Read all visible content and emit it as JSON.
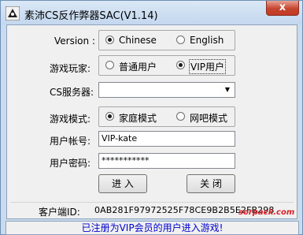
{
  "window": {
    "title": "素沛CS反作弊器SAC(V1.14)",
    "close_label": "x"
  },
  "version": {
    "label": "Version :",
    "options": [
      {
        "label": "Chinese",
        "selected": true
      },
      {
        "label": "English",
        "selected": false
      }
    ]
  },
  "player": {
    "label": "游戏玩家:",
    "options": [
      {
        "label": "普通用户",
        "selected": false
      },
      {
        "label": "VIP用户",
        "selected": true
      }
    ]
  },
  "server": {
    "label": "CS服务器:",
    "value": ""
  },
  "mode": {
    "label": "游戏模式:",
    "options": [
      {
        "label": "家庭模式",
        "selected": true
      },
      {
        "label": "网吧模式",
        "selected": false
      }
    ]
  },
  "account": {
    "label": "用户帐号:",
    "value": "VIP-kate"
  },
  "password": {
    "label": "用户密码:",
    "value": "***********"
  },
  "buttons": {
    "enter": "进 入",
    "close": "关 闭"
  },
  "client_id": {
    "label": "客户端ID:",
    "value": "0AB281F97972525F78CE9B2B5E2FB298"
  },
  "watermark": "sorpack.com",
  "status": "已注册为VIP会员的用户进入游戏!"
}
